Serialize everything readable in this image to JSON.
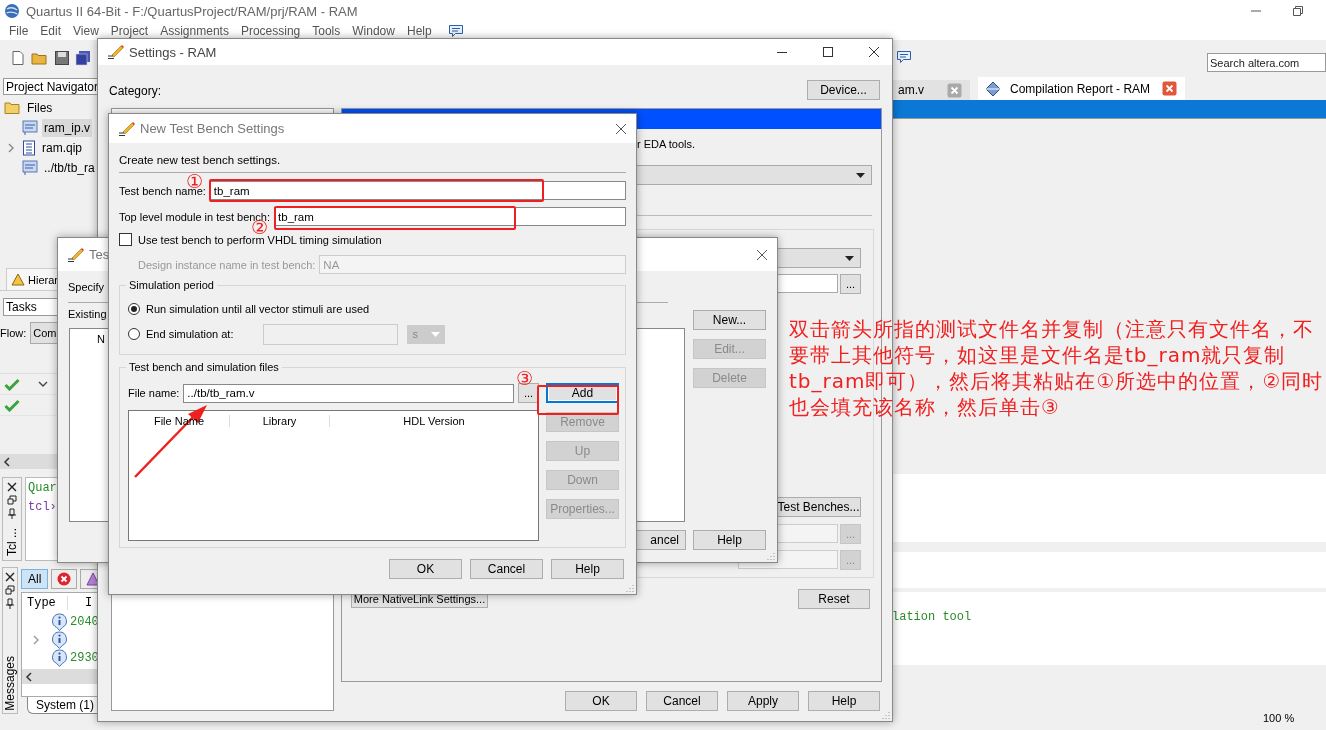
{
  "main": {
    "title": "Quartus II 64-Bit - F:/QuartusProject/RAM/prj/RAM - RAM",
    "menu": [
      "File",
      "Edit",
      "View",
      "Project",
      "Assignments",
      "Processing",
      "Tools",
      "Window",
      "Help"
    ],
    "search": {
      "placeholder": "Search altera.com"
    },
    "navigator": {
      "label": "Project Navigator",
      "tree": [
        {
          "label": "Files",
          "kind": "folder",
          "selected": false,
          "children": [
            {
              "label": "ram_ip.v",
              "kind": "verilog",
              "selected": true,
              "collapsed": false
            },
            {
              "label": "ram.qip",
              "kind": "qip",
              "selected": false,
              "collapsed": true
            },
            {
              "label": "../tb/tb_ra",
              "kind": "verilog",
              "selected": false,
              "collapsed": false
            }
          ]
        }
      ]
    },
    "hierarchy_tab": "Hierar",
    "tasks_label": "Tasks",
    "flow": {
      "label": "Flow:",
      "value": "Com"
    },
    "tasks": [
      {
        "expanded": true
      },
      {
        "expanded": false
      }
    ],
    "tcl": {
      "label": "Tcl ...",
      "lines": [
        {
          "kind": "info",
          "text": "Quar"
        },
        {
          "kind": "prompt",
          "text": "tcl›"
        }
      ]
    },
    "messages": {
      "label": "Messages",
      "filters": [
        {
          "kind": "all",
          "label": "All",
          "selected": true
        },
        {
          "kind": "error",
          "selected": false
        },
        {
          "kind": "warning",
          "selected": false
        }
      ],
      "columns": [
        "Type",
        "I"
      ],
      "rows": [
        {
          "id": "2040",
          "collapsed": false
        },
        {
          "collapsed": true
        },
        {
          "id": "2930",
          "collapsed": false
        }
      ],
      "tab": "System (1)"
    },
    "doc_tabs": [
      {
        "label": "am.v",
        "selected": false
      },
      {
        "label": "Compilation Report - RAM",
        "selected": true
      }
    ],
    "message_text": "lation tool",
    "zoom": "100 %"
  },
  "settings": {
    "title": "Settings - RAM",
    "category_label": "Category:",
    "device_button": "Device...",
    "panel_text": "r EDA tools.",
    "test_benches_button": "Test Benches...",
    "nativelink_button": "More NativeLink Settings...",
    "reset_button": "Reset",
    "browse": "...",
    "footer": [
      "OK",
      "Cancel",
      "Apply",
      "Help"
    ]
  },
  "test_benches": {
    "title": "Tes",
    "instruction": "Specify",
    "existing_label": "Existing",
    "column": "N",
    "side_buttons": [
      {
        "label": "New...",
        "disabled": false
      },
      {
        "label": "Edit...",
        "disabled": true
      },
      {
        "label": "Delete",
        "disabled": true
      }
    ],
    "footer": [
      "ancel",
      "Help"
    ]
  },
  "new_test_bench": {
    "title": "New Test Bench Settings",
    "intro": "Create new test bench settings.",
    "name_label": "Test bench name:",
    "name_value": "tb_ram",
    "top_label": "Top level module in test bench:",
    "top_value": "tb_ram",
    "vhdl_timing": {
      "label": "Use test bench to perform VHDL timing simulation",
      "checked": false
    },
    "instance": {
      "label": "Design instance name in test bench:",
      "value": "NA",
      "disabled": true
    },
    "period": {
      "legend": "Simulation period",
      "options": [
        {
          "label": "Run simulation until all vector stimuli are used",
          "selected": true
        },
        {
          "label": "End simulation at:",
          "selected": false
        }
      ],
      "unit": "s"
    },
    "files": {
      "legend": "Test bench and simulation files",
      "file_label": "File name:",
      "file_value": "../tb/tb_ram.v",
      "browse": "...",
      "columns": [
        "File Name",
        "Library",
        "HDL Version"
      ],
      "buttons": [
        {
          "label": "Add",
          "disabled": false,
          "focused": true
        },
        {
          "label": "Remove",
          "disabled": true,
          "focused": false
        },
        {
          "label": "Up",
          "disabled": true,
          "focused": false
        },
        {
          "label": "Down",
          "disabled": true,
          "focused": false
        },
        {
          "label": "Properties...",
          "disabled": true,
          "focused": false
        }
      ]
    },
    "footer": [
      "OK",
      "Cancel",
      "Help"
    ]
  },
  "annotations": {
    "markers": [
      "①",
      "②",
      "③"
    ],
    "note": "双击箭头所指的测试文件名并复制（注意只有文件名，不要带上其他符号，如这里是文件名是tb_ram就只复制tb_ram即可），然后将其粘贴在①所选中的位置，②同时也会填充该名称，然后单击③"
  }
}
